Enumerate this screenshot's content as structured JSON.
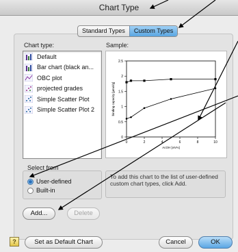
{
  "window": {
    "title": "Chart Type"
  },
  "tabs": [
    {
      "label": "Standard Types",
      "active": false
    },
    {
      "label": "Custom Types",
      "active": true
    }
  ],
  "chart_type": {
    "label": "Chart type:",
    "items": [
      {
        "label": "Default",
        "icon": "bar-chart-icon"
      },
      {
        "label": "Bar chart (black an...",
        "icon": "bar-chart-icon"
      },
      {
        "label": "OBC plot",
        "icon": "line-chart-icon"
      },
      {
        "label": "projected grades",
        "icon": "scatter-icon"
      },
      {
        "label": "Simple Scatter Plot",
        "icon": "scatter-icon"
      },
      {
        "label": "Simple Scatter Plot 2",
        "icon": "scatter-icon"
      }
    ]
  },
  "sample": {
    "label": "Sample:",
    "ylabel": "binding capacity [µmol/g]",
    "xlabel": "AcOH [v/v%]",
    "y_ticks": [
      "2.5",
      "2",
      "1.5",
      "1",
      "0.5",
      "0"
    ],
    "x_ticks": [
      "0",
      "2",
      "4",
      "6",
      "8",
      "10"
    ],
    "series": [
      {
        "x": [
          0,
          0.5,
          2,
          5,
          10
        ],
        "y": [
          1.8,
          1.85,
          1.85,
          1.9,
          1.9
        ]
      },
      {
        "x": [
          0,
          0.5,
          2,
          5,
          10
        ],
        "y": [
          0.6,
          0.65,
          0.95,
          1.25,
          1.6
        ]
      }
    ]
  },
  "select_from": {
    "label": "Select from",
    "options": [
      {
        "label": "User-defined",
        "selected": true
      },
      {
        "label": "Built-in",
        "selected": false
      }
    ]
  },
  "description": "To add this chart to the list of user-defined custom chart types, click Add.",
  "buttons": {
    "add": "Add...",
    "delete": "Delete",
    "set_default": "Set as Default Chart",
    "cancel": "Cancel",
    "ok": "OK",
    "help": "?"
  },
  "colors": {
    "accent": "#5aa6e2",
    "series": "#000000"
  }
}
